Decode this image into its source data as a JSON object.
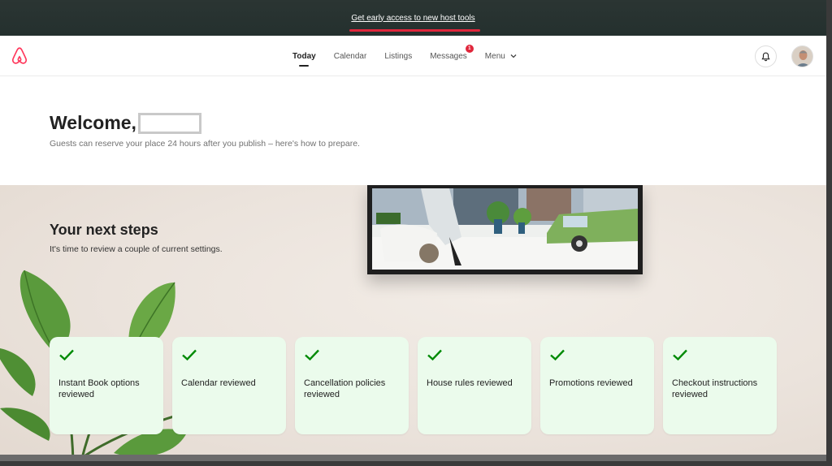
{
  "banner": {
    "link_text": "Get early access to new host tools"
  },
  "header": {
    "nav": [
      {
        "label": "Today",
        "active": true
      },
      {
        "label": "Calendar"
      },
      {
        "label": "Listings"
      },
      {
        "label": "Messages",
        "badge": "1"
      },
      {
        "label": "Menu"
      }
    ]
  },
  "welcome": {
    "title": "Welcome,",
    "subtitle": "Guests can reserve your place 24 hours after you publish – here's how to prepare."
  },
  "steps": {
    "title": "Your next steps",
    "subtitle": "It's time to review a couple of current settings.",
    "cards": [
      {
        "label": "Instant Book options reviewed"
      },
      {
        "label": "Calendar reviewed"
      },
      {
        "label": "Cancellation policies reviewed"
      },
      {
        "label": "House rules reviewed"
      },
      {
        "label": "Promotions reviewed"
      },
      {
        "label": "Checkout instructions reviewed"
      }
    ]
  },
  "colors": {
    "brand": "#FF385C",
    "check": "#008A05",
    "card_bg": "#EBFBEC",
    "badge": "#E0263B"
  },
  "icons": [
    "airbnb-logo-icon",
    "chevron-down-icon",
    "bell-icon",
    "check-icon"
  ]
}
